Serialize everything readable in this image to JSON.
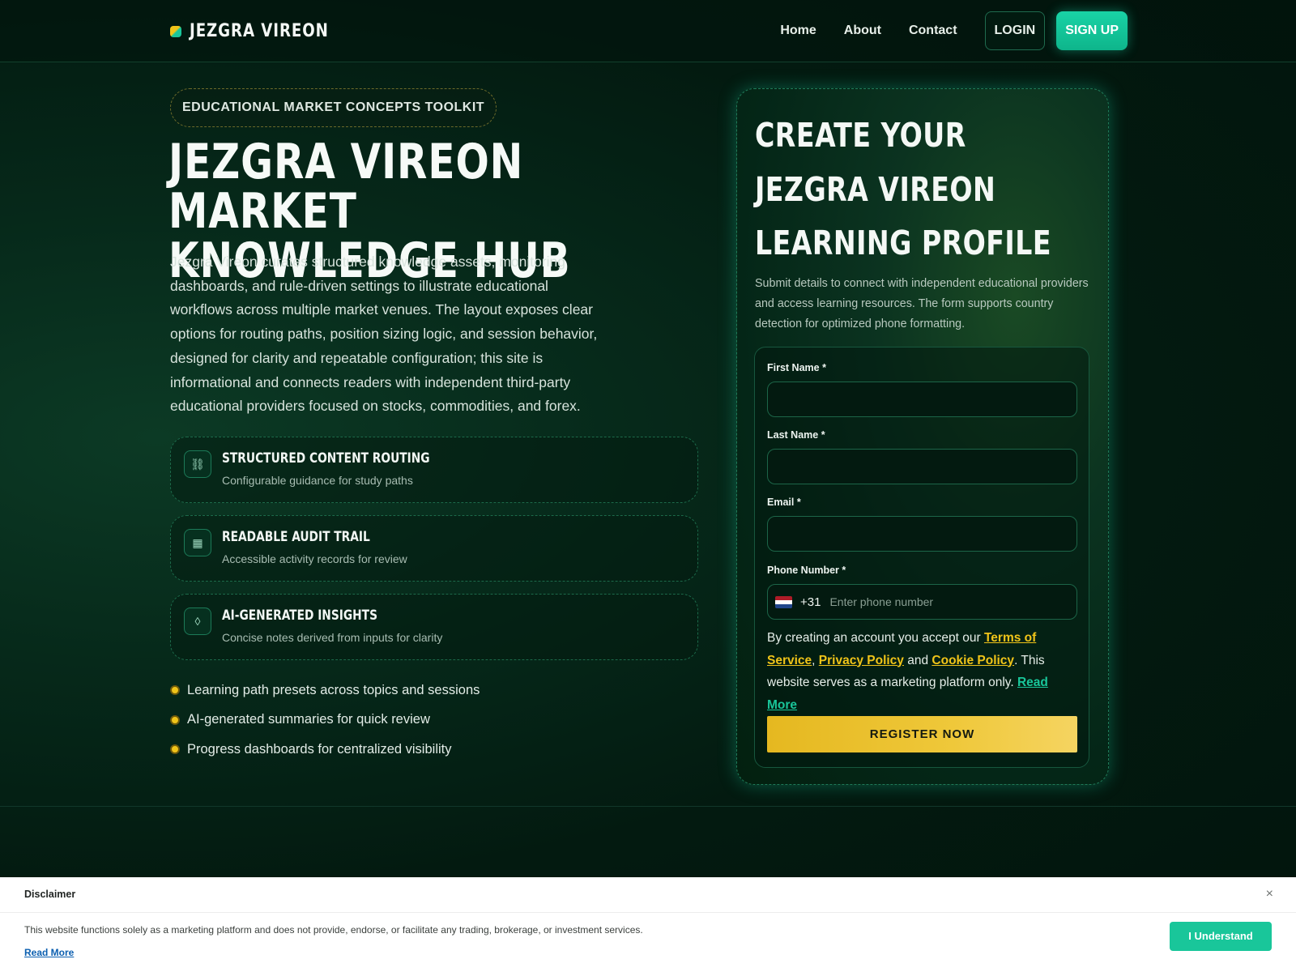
{
  "header": {
    "brand": "JEZGRA VIREON",
    "nav": [
      "Home",
      "About",
      "Contact"
    ],
    "login_label": "LOGIN",
    "signup_label": "SIGN UP"
  },
  "hero": {
    "badge": "EDUCATIONAL MARKET CONCEPTS TOOLKIT",
    "title": "JEZGRA VIREON MARKET KNOWLEDGE HUB",
    "description": "Jezgra Vireon curates structured knowledge assets, monitoring dashboards, and rule-driven settings to illustrate educational workflows across multiple market venues. The layout exposes clear options for routing paths, position sizing logic, and session behavior, designed for clarity and repeatable configuration; this site is informational and connects readers with independent third-party educational providers focused on stocks, commodities, and forex.",
    "features": [
      {
        "icon": "link-icon",
        "glyph": "⛓",
        "title": "STRUCTURED CONTENT ROUTING",
        "desc": "Configurable guidance for study paths"
      },
      {
        "icon": "grid-icon",
        "glyph": "▦",
        "title": "READABLE AUDIT TRAIL",
        "desc": "Accessible activity records for review"
      },
      {
        "icon": "diamond-icon",
        "glyph": "◊",
        "title": "AI-GENERATED INSIGHTS",
        "desc": "Concise notes derived from inputs for clarity"
      }
    ],
    "bullets": [
      "Learning path presets across topics and sessions",
      "AI-generated summaries for quick review",
      "Progress dashboards for centralized visibility"
    ]
  },
  "form": {
    "title": "CREATE YOUR JEZGRA VIREON LEARNING PROFILE",
    "subtitle": "Submit details to connect with independent educational providers and access learning resources. The form supports country detection for optimized phone formatting.",
    "first_name_label": "First Name *",
    "last_name_label": "Last Name *",
    "email_label": "Email *",
    "phone_label": "Phone Number *",
    "dial_code": "+31",
    "phone_placeholder": "Enter phone number",
    "consent": {
      "prefix": "By creating an account you accept our ",
      "terms": "Terms of Service",
      "comma": ",",
      "privacy": "Privacy Policy",
      "and": " and ",
      "cookie": "Cookie Policy",
      "suffix": ". This website serves as a marketing platform only. ",
      "read_more": "Read More"
    },
    "register_label": "REGISTER NOW"
  },
  "disclaimer": {
    "title": "Disclaimer",
    "close": "×",
    "text": "This website functions solely as a marketing platform and does not provide, endorse, or facilitate any trading, brokerage, or investment services.",
    "read_more": "Read More",
    "button": "I Understand"
  },
  "colors": {
    "accent_green": "#19c69a",
    "accent_yellow": "#f0c419",
    "background": "#02140c",
    "flag": [
      "#ae1c28",
      "#ffffff",
      "#21468b"
    ]
  }
}
